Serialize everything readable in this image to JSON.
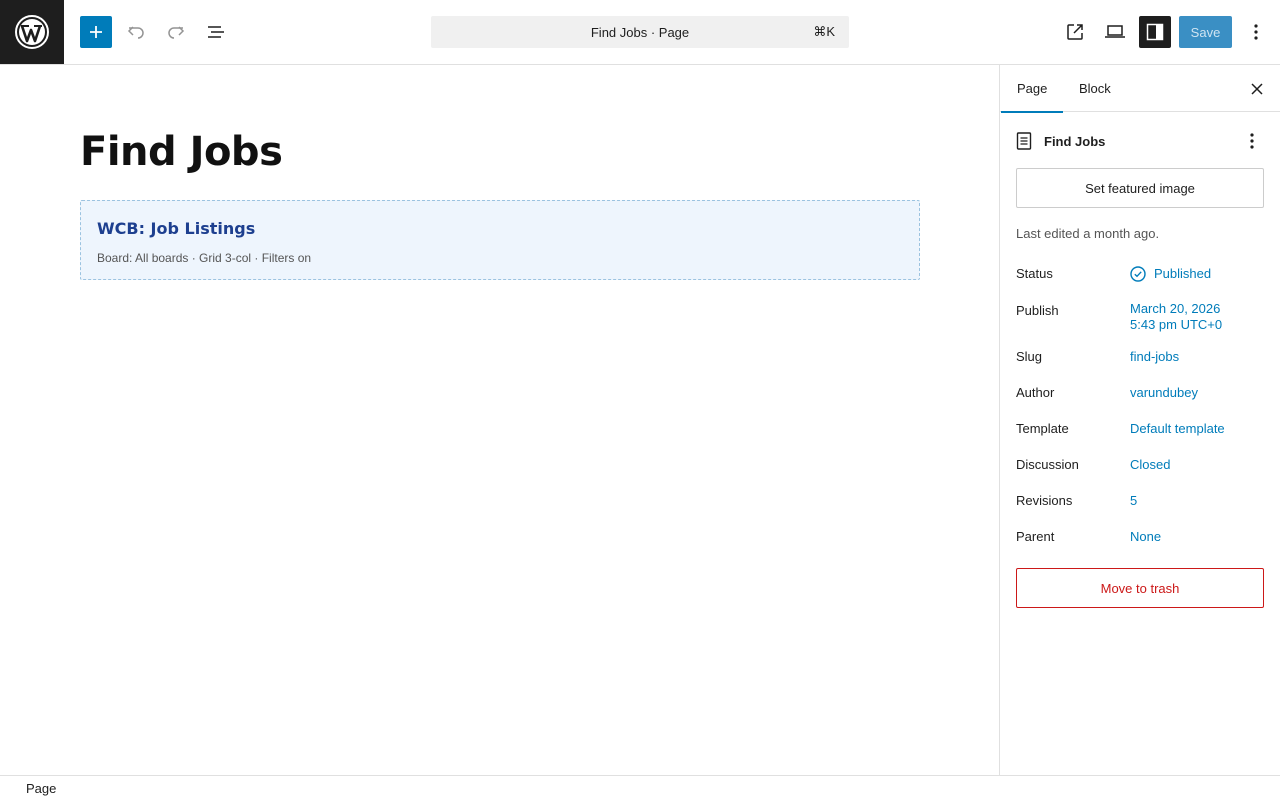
{
  "topbar": {
    "command_bar": {
      "label": "Find Jobs · Page",
      "shortcut": "⌘K"
    },
    "save_label": "Save",
    "icons": [
      "wordpress-logo",
      "plus-icon",
      "undo-icon",
      "redo-icon",
      "list-view-icon",
      "external-link-icon",
      "desktop-icon",
      "sidebar-icon",
      "more-vertical-icon"
    ]
  },
  "canvas": {
    "title": "Find Jobs",
    "block": {
      "title": "WCB: Job Listings",
      "meta": "Board: All boards · Grid 3-col · Filters on"
    }
  },
  "sidebar": {
    "tabs": [
      {
        "label": "Page",
        "active": true
      },
      {
        "label": "Block",
        "active": false
      }
    ],
    "doc_title": "Find Jobs",
    "featured_image_label": "Set featured image",
    "last_edited": "Last edited a month ago.",
    "rows": [
      {
        "key": "Status",
        "value": "Published"
      },
      {
        "key": "Publish",
        "value": "March 20, 2026",
        "value2": "5:43 pm UTC+0"
      },
      {
        "key": "Slug",
        "value": "find-jobs"
      },
      {
        "key": "Author",
        "value": "varundubey"
      },
      {
        "key": "Template",
        "value": "Default template"
      },
      {
        "key": "Discussion",
        "value": "Closed"
      },
      {
        "key": "Revisions",
        "value": "5"
      },
      {
        "key": "Parent",
        "value": "None"
      }
    ],
    "trash_label": "Move to trash"
  },
  "footer": {
    "breadcrumb": "Page"
  },
  "colors": {
    "accent": "#007cba",
    "danger": "#cc1818",
    "dark": "#1e1e1e"
  }
}
